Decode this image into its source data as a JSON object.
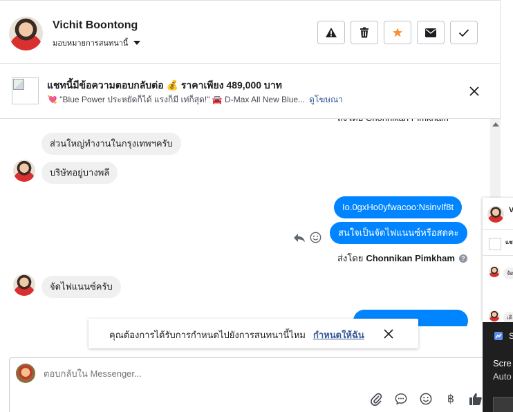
{
  "header": {
    "name": "Vichit Boontong",
    "assign_label": "มอบหมายการสนทนานี้"
  },
  "header_buttons": [
    "warning-icon",
    "trash-icon",
    "star-icon",
    "envelope-icon",
    "check-icon"
  ],
  "colors": {
    "accent": "#0084ff",
    "star": "#f7923a",
    "link": "#365899"
  },
  "ad": {
    "title": "แชทนี้มีข้อความตอบกลับต่อ 💰 ราคาเพียง 489,000 บาท",
    "description": "💘 \"Blue Power ประหยัดก็ได้ แรงก็มี เท่ก็สุด!\" 🚘 D-Max All New Blue...",
    "link": "ดูโฆษณา"
  },
  "thread": {
    "partial_sentby": "ส่งโดย Chonnikan Pimkham",
    "messages": [
      {
        "dir": "in",
        "text": "ส่วนใหญ่ทำงานในกรุงเทพฯครับ"
      },
      {
        "dir": "in",
        "text": "บริษัทอยู่บางพลี"
      },
      {
        "dir": "out",
        "text": "Io.0gxHo0yfwacoo:NsinvIf8t"
      },
      {
        "dir": "out",
        "text": "สนใจเป็นจัดไฟแนนซ์หรือสดคะ"
      },
      {
        "dir": "in",
        "text": "จัดไฟแนนซ์ครับ"
      }
    ],
    "sent_by_label": "ส่งโดย",
    "sent_by_name": "Chonnikan Pimkham"
  },
  "notice": {
    "text": "คุณต้องการได้รับการกำหนดไปยังการสนทนานี้ไหม",
    "link": "กำหนดให้ฉัน"
  },
  "composer": {
    "placeholder": "ตอบกลับใน Messenger..."
  },
  "side": {
    "name_fragment": "V",
    "ad_fragment": "แช",
    "msg1": "จัด",
    "msg2": "เดิ",
    "bottom1": "S",
    "bottom2": "Scre",
    "bottom3": "Auto"
  }
}
